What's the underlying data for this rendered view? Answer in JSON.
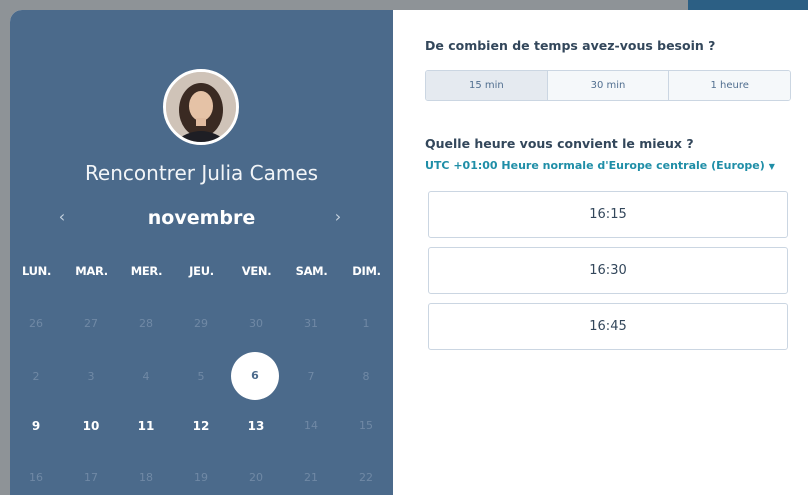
{
  "host": {
    "title": "Rencontrer Julia Cames"
  },
  "calendar": {
    "month": "novembre",
    "prev_icon": "‹",
    "next_icon": "›",
    "weekdays": [
      "LUN.",
      "MAR.",
      "MER.",
      "JEU.",
      "VEN.",
      "SAM.",
      "DIM."
    ],
    "weeks": [
      [
        "26",
        "27",
        "28",
        "29",
        "30",
        "31",
        "1"
      ],
      [
        "2",
        "3",
        "4",
        "5",
        "6",
        "7",
        "8"
      ],
      [
        "9",
        "10",
        "11",
        "12",
        "13",
        "14",
        "15"
      ],
      [
        "16",
        "17",
        "18",
        "19",
        "20",
        "21",
        "22"
      ]
    ],
    "selected_day": "6"
  },
  "duration": {
    "question": "De combien de temps avez-vous besoin ?",
    "options": [
      "15 min",
      "30 min",
      "1 heure"
    ],
    "selected": "15 min"
  },
  "time": {
    "question": "Quelle heure vous convient le mieux ?",
    "timezone": "UTC +01:00 Heure normale d'Europe centrale (Europe)",
    "timezone_caret": "▼",
    "slots": [
      "16:15",
      "16:30",
      "16:45"
    ]
  },
  "colors": {
    "panel": "#4b6a8b",
    "accent": "#1f8ea7"
  }
}
